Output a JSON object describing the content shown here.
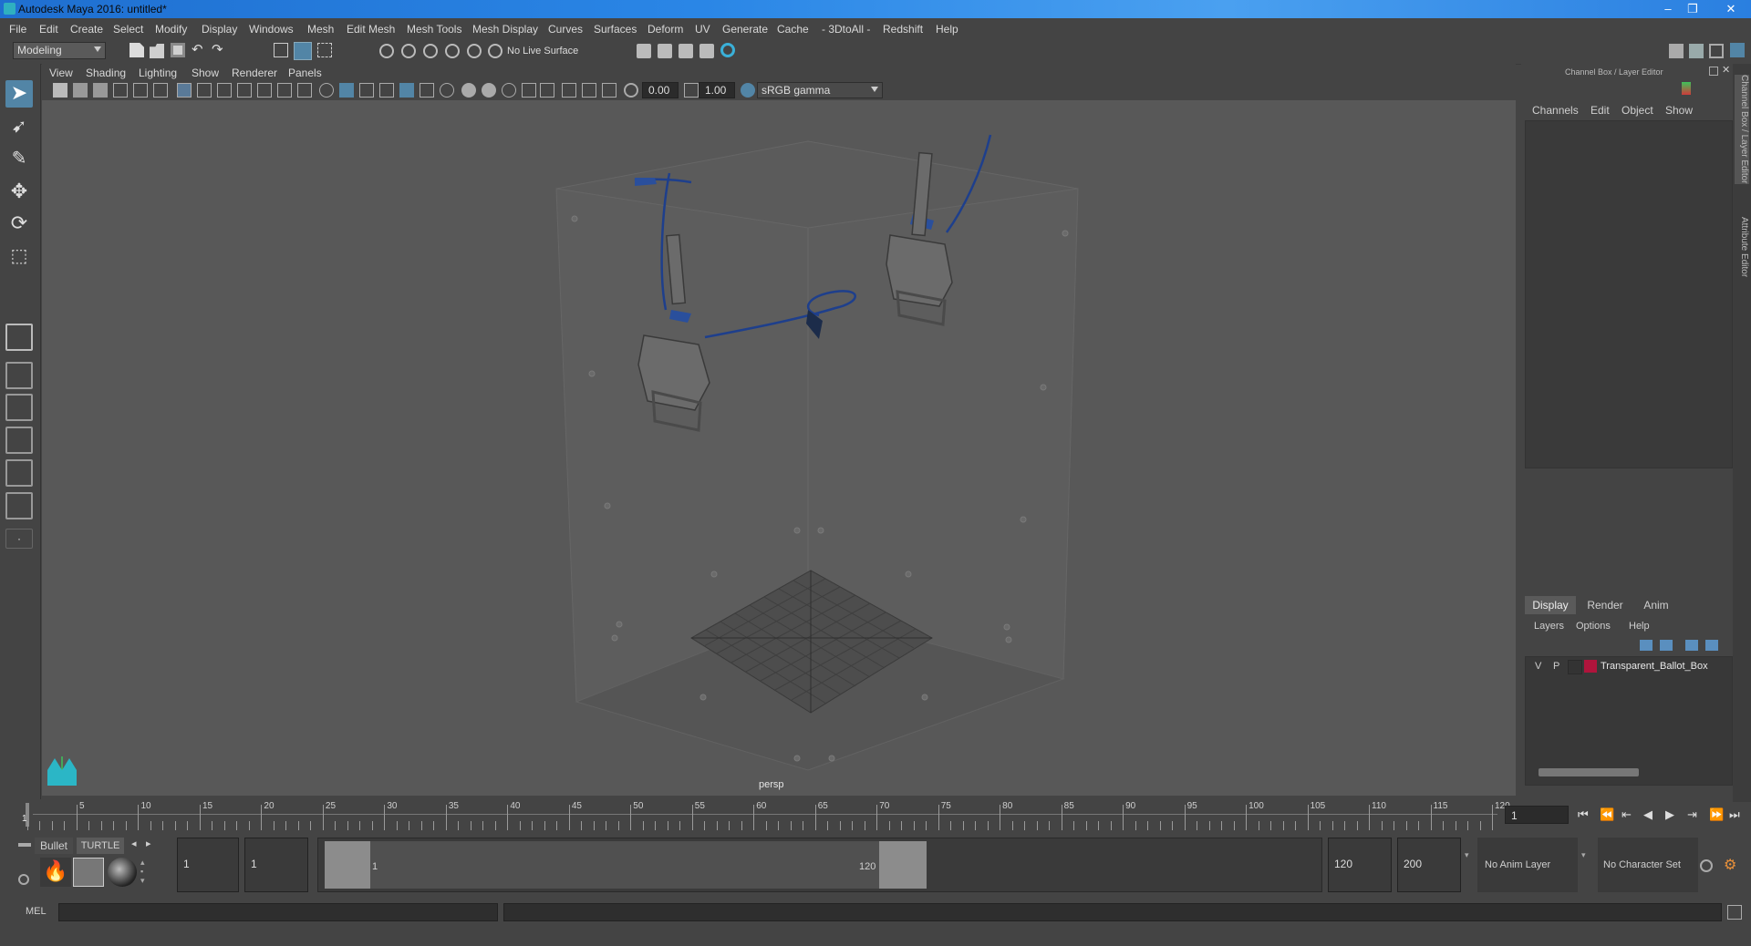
{
  "window": {
    "title": "Autodesk Maya 2016: untitled*"
  },
  "menu": [
    "File",
    "Edit",
    "Create",
    "Select",
    "Modify",
    "Display",
    "Windows",
    "Mesh",
    "Edit Mesh",
    "Mesh Tools",
    "Mesh Display",
    "Curves",
    "Surfaces",
    "Deform",
    "UV",
    "Generate",
    "Cache",
    "- 3DtoAll -",
    "Redshift",
    "Help"
  ],
  "status": {
    "mode": "Modeling",
    "live_surface": "No Live Surface"
  },
  "panel": {
    "menu": [
      "View",
      "Shading",
      "Lighting",
      "Show",
      "Renderer",
      "Panels"
    ],
    "exposure": "0.00",
    "gamma": "1.00",
    "color_space": "sRGB gamma",
    "camera": "persp"
  },
  "channel_box": {
    "header": "Channel Box / Layer Editor",
    "menu": [
      "Channels",
      "Edit",
      "Object",
      "Show"
    ]
  },
  "layer_editor": {
    "tabs": [
      "Display",
      "Render",
      "Anim"
    ],
    "menu": [
      "Layers",
      "Options",
      "Help"
    ],
    "layers": [
      {
        "v": "V",
        "p": "P",
        "name": "Transparent_Ballot_Box",
        "color": "#b0143c"
      }
    ]
  },
  "side_tabs": [
    "Channel Box / Layer Editor",
    "Attribute Editor"
  ],
  "timeline": {
    "ticks": [
      "5",
      "10",
      "15",
      "20",
      "25",
      "30",
      "35",
      "40",
      "45",
      "50",
      "55",
      "60",
      "65",
      "70",
      "75",
      "80",
      "85",
      "90",
      "95",
      "100",
      "105",
      "110",
      "115",
      "120"
    ],
    "current_marker": "1",
    "current_frame": "1"
  },
  "range": {
    "shelf_tabs": [
      "Bullet",
      "TURTLE"
    ],
    "start": "1",
    "playback_start": "1",
    "slider_start": "1",
    "slider_end": "120",
    "playback_end": "120",
    "end": "200",
    "anim_layer": "No Anim Layer",
    "char_set": "No Character Set"
  },
  "command": {
    "label": "MEL"
  },
  "colors": {
    "accent": "#5285a6",
    "viewport": "#585858",
    "panel": "#444444",
    "wire": "#1e3f8c"
  }
}
